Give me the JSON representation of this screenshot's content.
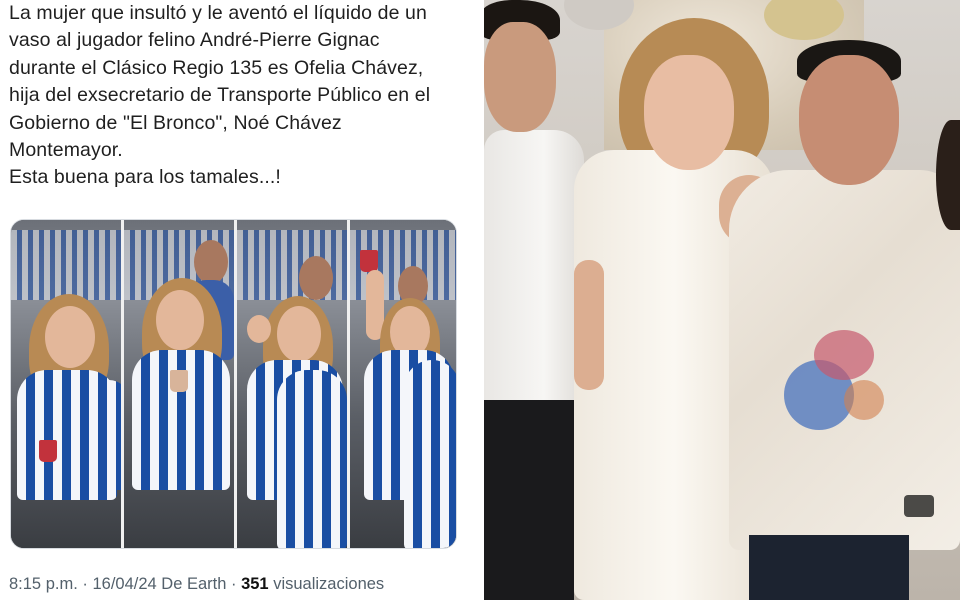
{
  "tweet": {
    "text_lines": [
      "La mujer que insultó y le aventó el líquido de un",
      "vaso al jugador felino André-Pierre Gignac",
      "durante el Clásico Regio 135 es Ofelia Chávez,",
      "hija del exsecretario de Transporte Público en el",
      "Gobierno de \"El Bronco\", Noé Chávez",
      "Montemayor.",
      "Esta buena para los tamales...!"
    ],
    "meta": {
      "time": "8:15 p.m.",
      "separator": " · ",
      "date_source": "16/04/24 De Earth",
      "views_count": "351",
      "views_label": " visualizaciones"
    }
  },
  "colors": {
    "text": "#1f1f1f",
    "meta_text": "#53606b",
    "jersey_blue": "#1a4ea3",
    "jersey_white": "#f4f6fa",
    "cup_red": "#c2323c"
  }
}
